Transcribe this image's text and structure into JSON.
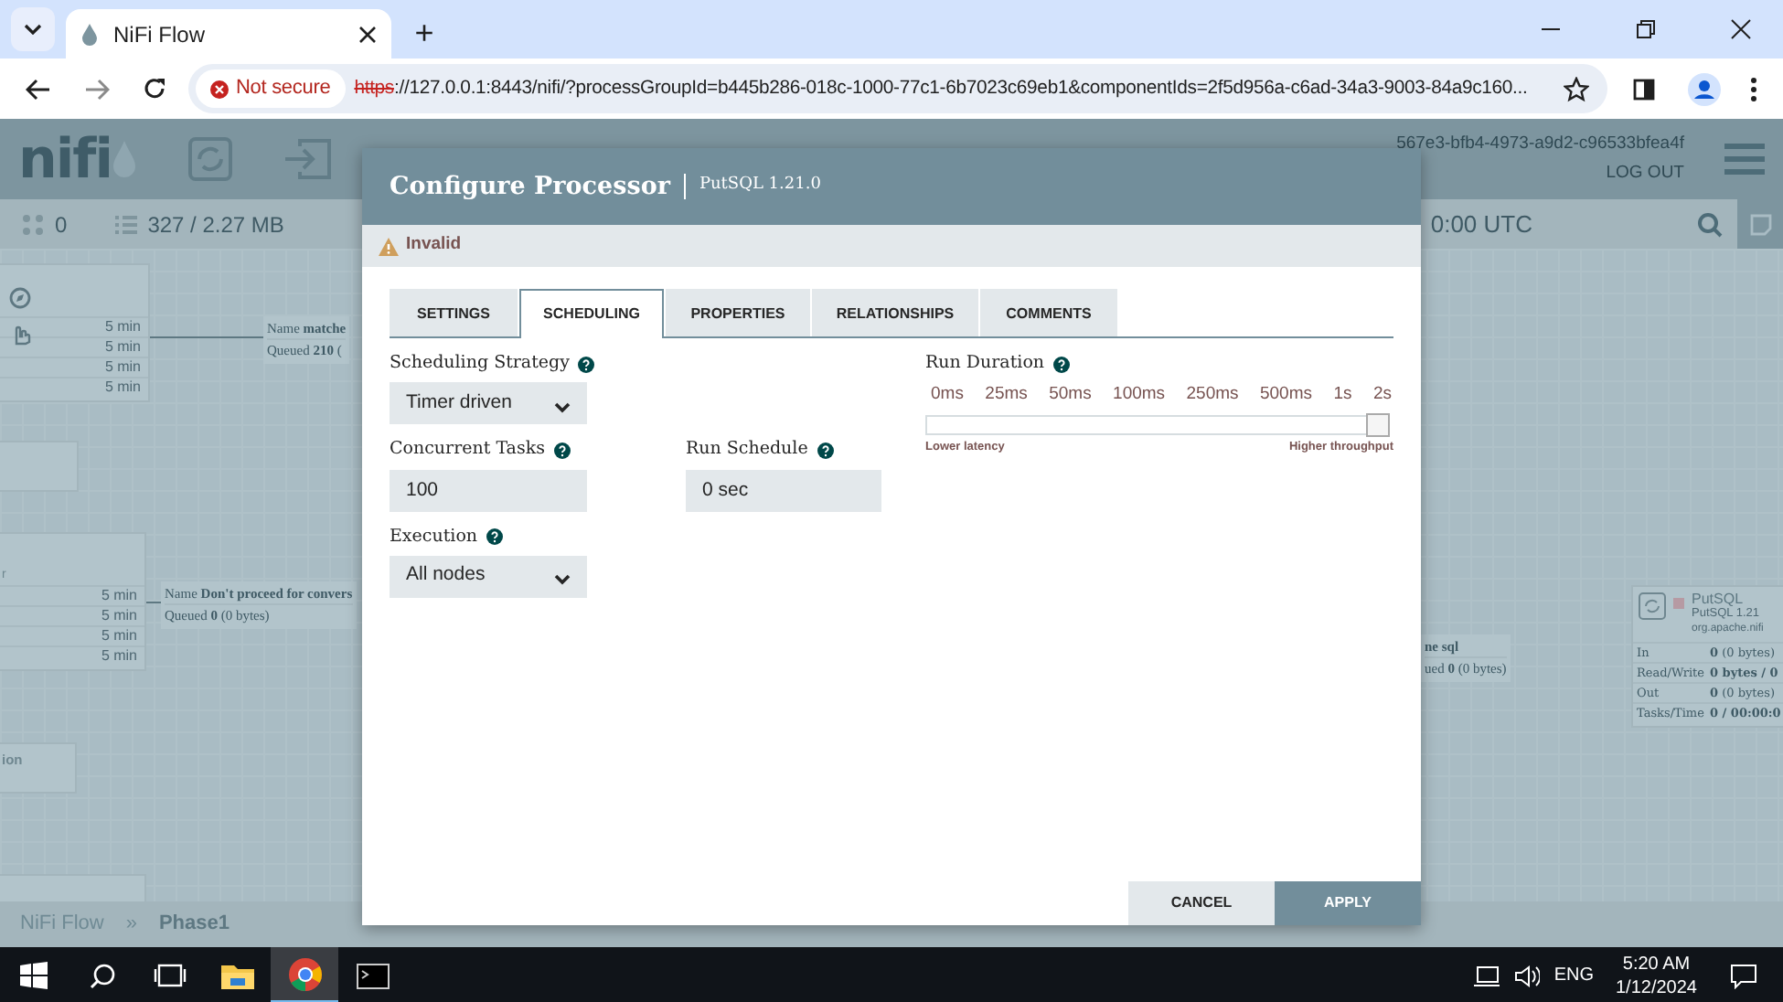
{
  "browser": {
    "tab": {
      "title": "NiFi Flow",
      "selected": true
    },
    "new_tab": "+",
    "security": "Not secure",
    "url_scheme": "https",
    "url_rest": "://127.0.0.1:8443/nifi/?processGroupId=b445b286-018c-1000-77c1-6b7023c69eb1&componentIds=2f5d956a-c6ad-34a3-9003-84a9c160..."
  },
  "nifi_header": {
    "logo": "nifi",
    "user": "567e3-bfb4-4973-a9d2-c96533bfea4f",
    "logout": "LOG OUT"
  },
  "status_bar": {
    "threads": "0",
    "queued": "327 / 2.27 MB",
    "time": "0:00 UTC"
  },
  "canvas": {
    "processor_1": {
      "rows": [
        "5 min",
        "5 min",
        "5 min",
        "5 min"
      ]
    },
    "connection_1": {
      "name_label": "Name",
      "name": "matche",
      "queued_label": "Queued",
      "queued": "210",
      "queued_size": "("
    },
    "processor_2": {
      "type_fragment": "r",
      "rows": [
        "5 min",
        "5 min",
        "5 min",
        "5 min"
      ]
    },
    "connection_2": {
      "name_label": "Name",
      "name": "Don't proceed for convers",
      "queued_label": "Queued",
      "queued": "0",
      "queued_size": "(0 bytes)"
    },
    "label_fragment": "ion",
    "connection_3": {
      "name": "ne sql",
      "queued_label": "ued",
      "queued": "0",
      "queued_size": "(0 bytes)"
    },
    "putsql": {
      "name": "PutSQL",
      "type": "PutSQL 1.21",
      "bundle": "org.apache.nifi",
      "stats": [
        {
          "label": "In",
          "value": "0",
          "detail": "(0 bytes)"
        },
        {
          "label": "Read/Write",
          "value": "0 bytes / 0"
        },
        {
          "label": "Out",
          "value": "0",
          "detail": "(0 bytes)"
        },
        {
          "label": "Tasks/Time",
          "value": "0 / 00:00:0"
        }
      ]
    }
  },
  "breadcrumb": [
    "NiFi Flow",
    "Phase1"
  ],
  "breadcrumb_separator": "»",
  "dialog": {
    "title": "Configure Processor",
    "subtitle": "PutSQL 1.21.0",
    "validation": "Invalid",
    "tabs": [
      {
        "label": "SETTINGS",
        "selected": false
      },
      {
        "label": "SCHEDULING",
        "selected": true
      },
      {
        "label": "PROPERTIES",
        "selected": false
      },
      {
        "label": "RELATIONSHIPS",
        "selected": false
      },
      {
        "label": "COMMENTS",
        "selected": false
      }
    ],
    "fields": [
      {
        "label": "Scheduling Strategy",
        "kind": "select",
        "value": "Timer driven"
      },
      {
        "label": "Concurrent Tasks",
        "kind": "input",
        "value": "100"
      },
      {
        "label": "Run Schedule",
        "kind": "input",
        "value": "0 sec"
      },
      {
        "label": "Execution",
        "kind": "select",
        "value": "All nodes"
      }
    ],
    "run_duration": {
      "label": "Run Duration",
      "ticks": [
        "0ms",
        "25ms",
        "50ms",
        "100ms",
        "250ms",
        "500ms",
        "1s",
        "2s"
      ],
      "level": 1,
      "min_label": "Lower latency",
      "max_label": "Higher throughput"
    },
    "buttons": [
      {
        "label": "CANCEL",
        "kind": "secondary"
      },
      {
        "label": "APPLY",
        "kind": "primary"
      }
    ]
  },
  "taskbar": {
    "language": "ENG",
    "time": "5:20 AM",
    "date": "1/12/2024"
  }
}
